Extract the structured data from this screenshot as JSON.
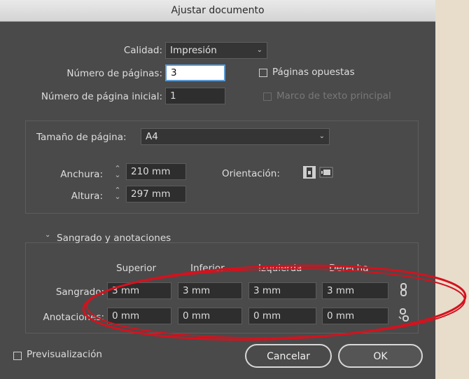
{
  "window": {
    "title": "Ajustar documento"
  },
  "top": {
    "quality_label": "Calidad:",
    "quality_value": "Impresión",
    "pages_label": "Número de páginas:",
    "pages_value": "3",
    "start_label": "Número de página inicial:",
    "start_value": "1",
    "facing_label": "Páginas opuestas",
    "primary_label": "Marco de texto principal"
  },
  "page": {
    "size_label": "Tamaño de página:",
    "size_value": "A4",
    "width_label": "Anchura:",
    "width_value": "210 mm",
    "height_label": "Altura:",
    "height_value": "297 mm",
    "orientation_label": "Orientación:"
  },
  "bleed": {
    "section_label": "Sangrado y anotaciones",
    "columns": [
      "Superior",
      "Inferior",
      "Izquierda",
      "Derecha"
    ],
    "bleed_label": "Sangrado:",
    "bleed_values": [
      "3 mm",
      "3 mm",
      "3 mm",
      "3 mm"
    ],
    "slug_label": "Anotaciones:",
    "slug_values": [
      "0 mm",
      "0 mm",
      "0 mm",
      "0 mm"
    ]
  },
  "footer": {
    "preview_label": "Previsualización",
    "cancel_label": "Cancelar",
    "ok_label": "OK"
  },
  "colors": {
    "annotation": "#d4121e",
    "dialog_bg": "#4a4a4a",
    "focus": "#5b9bd5"
  },
  "icons": [
    "chevron-down-icon",
    "stepper-icon",
    "portrait-icon",
    "landscape-icon",
    "chain-link-icon",
    "chain-broken-icon"
  ]
}
